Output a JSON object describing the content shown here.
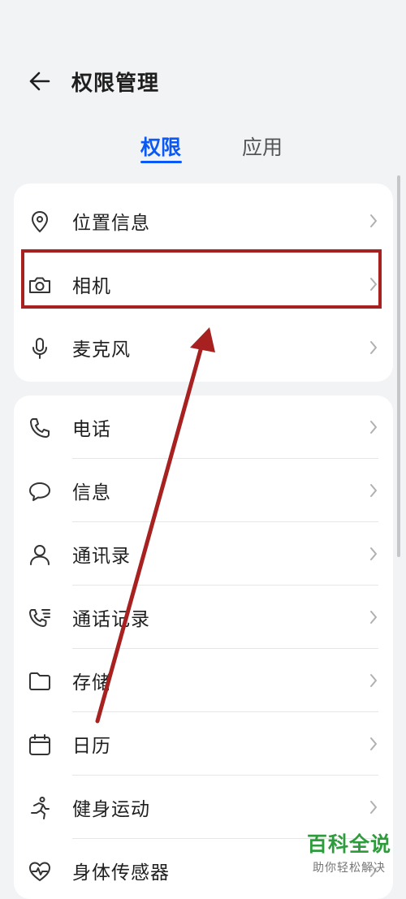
{
  "header": {
    "title": "权限管理"
  },
  "tabs": [
    {
      "label": "权限",
      "active": true
    },
    {
      "label": "应用",
      "active": false
    }
  ],
  "group1": [
    {
      "label": "位置信息",
      "icon": "location-pin-icon"
    },
    {
      "label": "相机",
      "icon": "camera-icon"
    },
    {
      "label": "麦克风",
      "icon": "microphone-icon"
    }
  ],
  "group2": [
    {
      "label": "电话",
      "icon": "phone-icon"
    },
    {
      "label": "信息",
      "icon": "message-icon"
    },
    {
      "label": "通讯录",
      "icon": "contacts-icon"
    },
    {
      "label": "通话记录",
      "icon": "call-log-icon"
    },
    {
      "label": "存储",
      "icon": "folder-icon"
    },
    {
      "label": "日历",
      "icon": "calendar-icon"
    },
    {
      "label": "健身运动",
      "icon": "running-icon"
    },
    {
      "label": "身体传感器",
      "icon": "heart-rate-icon"
    }
  ],
  "watermark": {
    "main": "百科全说",
    "sub": "助你轻松解决"
  },
  "colors": {
    "accent": "#0a59f7",
    "annotation": "#a82121",
    "watermark": "#2e9c3c"
  }
}
